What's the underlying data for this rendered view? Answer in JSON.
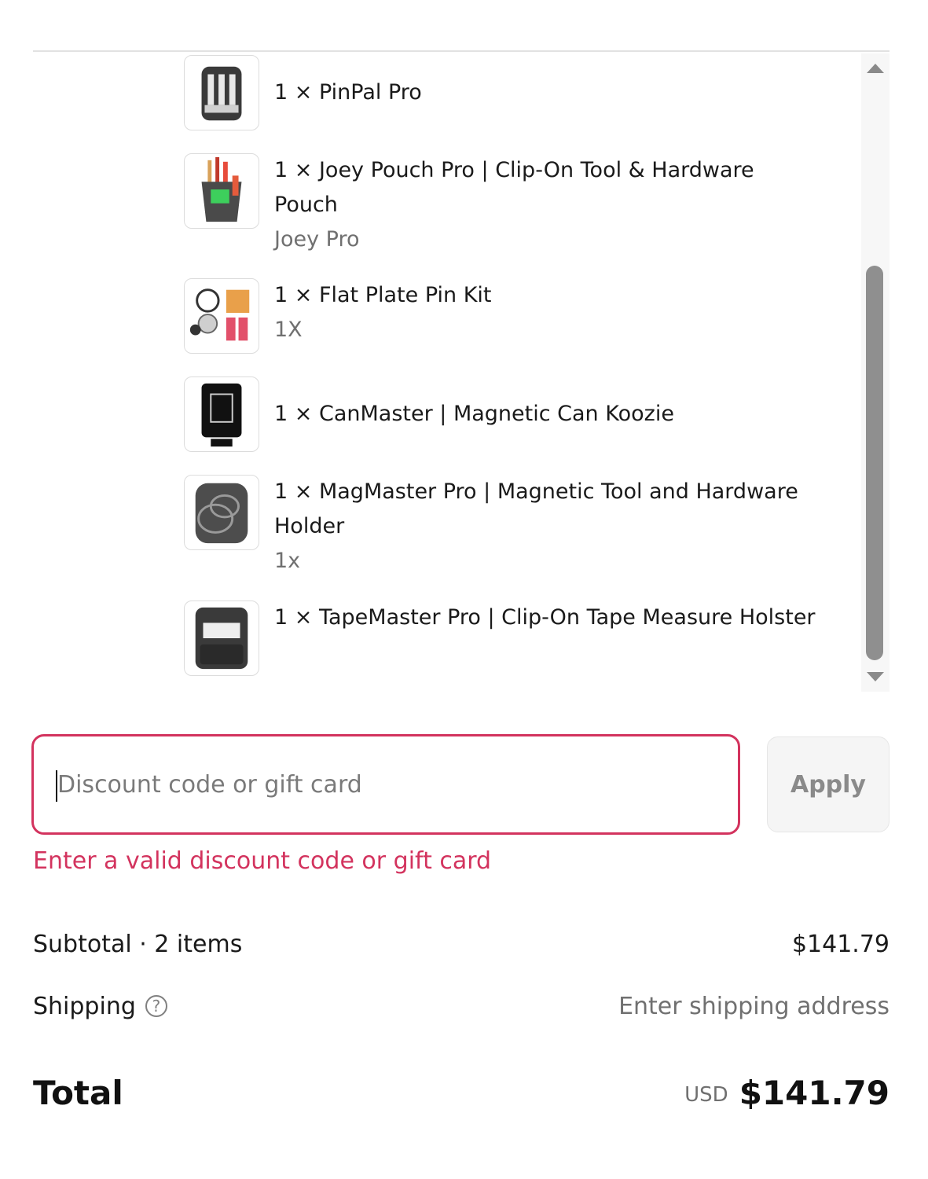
{
  "cart": {
    "items": [
      {
        "title": "1 × PinPal Pro",
        "variant": "",
        "icon": "pin-holder-icon"
      },
      {
        "title": "1 × Joey Pouch Pro | Clip-On Tool & Hardware Pouch",
        "variant": "Joey Pro",
        "icon": "tool-pouch-icon"
      },
      {
        "title": "1 × Flat Plate Pin Kit",
        "variant": "1X",
        "icon": "pin-kit-icon"
      },
      {
        "title": "1 × CanMaster | Magnetic Can Koozie",
        "variant": "",
        "icon": "can-koozie-icon"
      },
      {
        "title": "1 × MagMaster Pro | Magnetic Tool and Hardware Holder",
        "variant": "1x",
        "icon": "magnetic-holder-icon"
      },
      {
        "title": "1 × TapeMaster Pro | Clip-On Tape Measure Holster",
        "variant": "",
        "icon": "tape-holster-icon"
      }
    ]
  },
  "discount": {
    "placeholder": "Discount code or gift card",
    "value": "",
    "apply_label": "Apply",
    "error": "Enter a valid discount code or gift card",
    "error_color": "#d3335e"
  },
  "summary": {
    "subtotal_label": "Subtotal · 2 items",
    "subtotal_value": "$141.79",
    "shipping_label": "Shipping",
    "shipping_help_icon": "question-circle-icon",
    "shipping_value": "Enter shipping address",
    "total_label": "Total",
    "currency": "USD",
    "total_value": "$141.79"
  }
}
